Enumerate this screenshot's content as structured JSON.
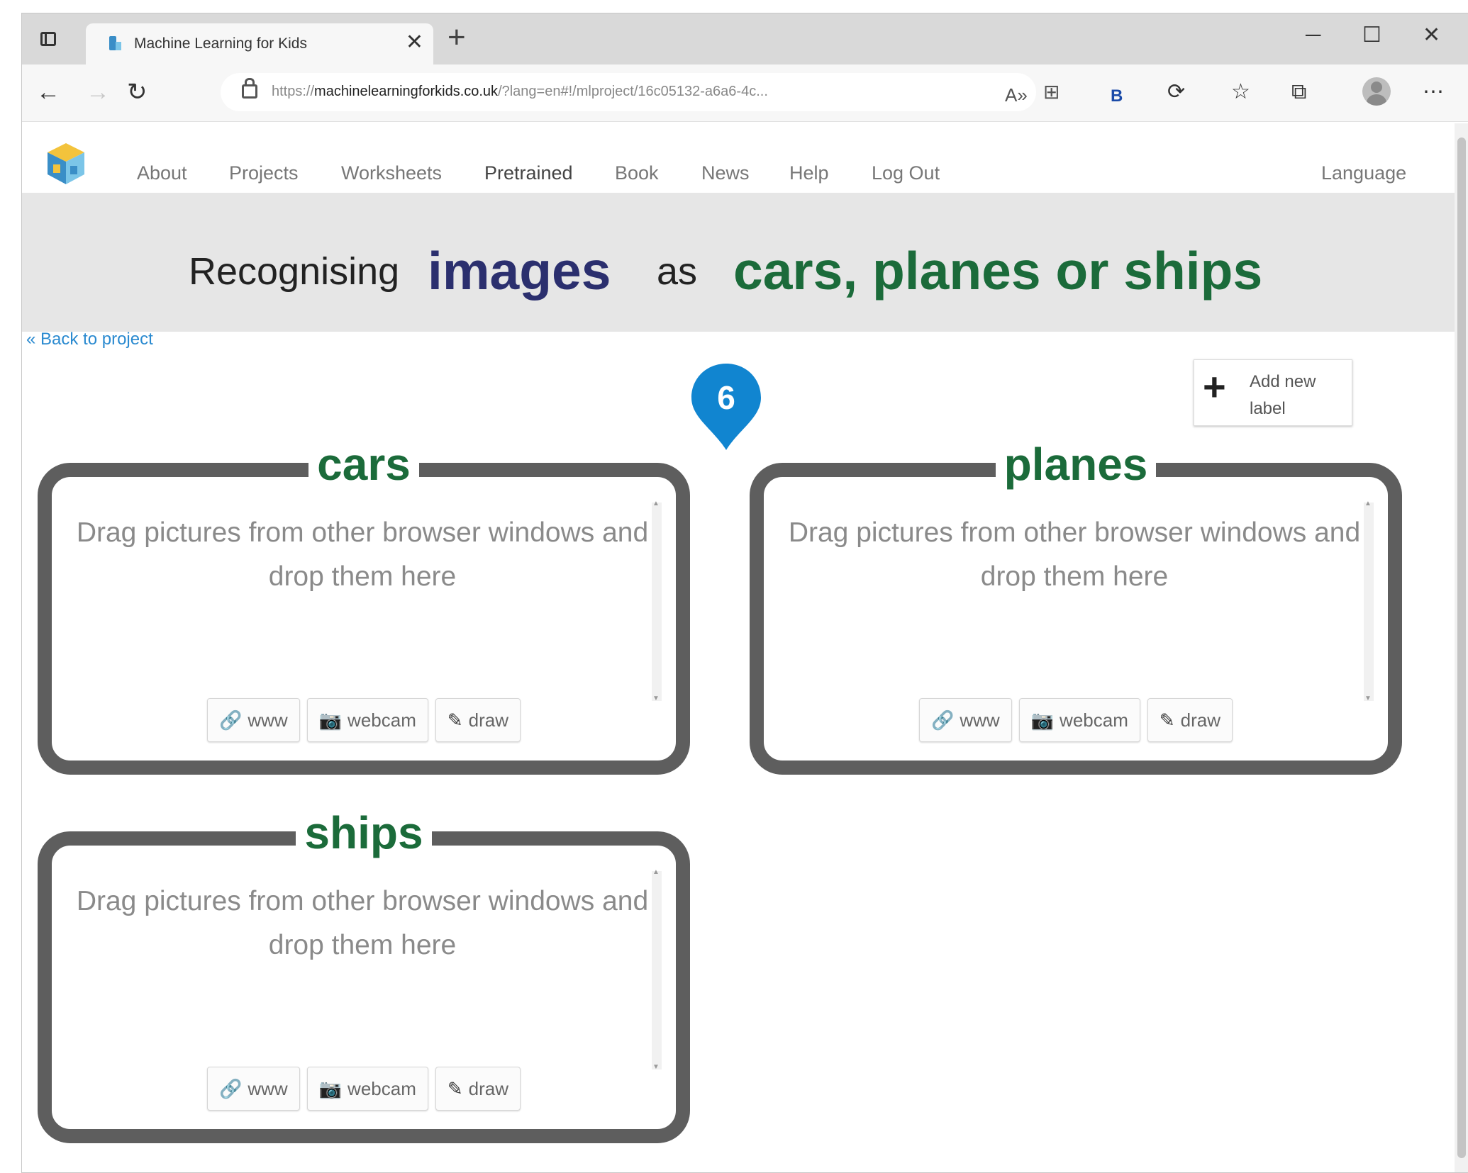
{
  "browser": {
    "tab_title": "Machine Learning for Kids",
    "tab_close": "✕",
    "new_tab": "+",
    "url_prefix": "https://",
    "url_host": "machinelearningforkids.co.uk",
    "url_rest": "/?lang=en#!/mlproject/16c05132-a6a6-4c..."
  },
  "nav": {
    "items": [
      "About",
      "Projects",
      "Worksheets",
      "Pretrained",
      "Book",
      "News",
      "Help",
      "Log Out"
    ],
    "language": "Language"
  },
  "header": {
    "word1": "Recognising",
    "word2": "images",
    "word3": "as",
    "word4": "cars, planes or ships"
  },
  "back_link": "« Back to project",
  "step_badge": "6",
  "add_label": "Add new label",
  "buckets": [
    {
      "title": "cars",
      "drop_text": "Drag pictures from other browser windows and drop them here",
      "buttons": [
        "www",
        "webcam",
        "draw"
      ]
    },
    {
      "title": "planes",
      "drop_text": "Drag pictures from other browser windows and drop them here",
      "buttons": [
        "www",
        "webcam",
        "draw"
      ]
    },
    {
      "title": "ships",
      "drop_text": "Drag pictures from other browser windows and drop them here",
      "buttons": [
        "www",
        "webcam",
        "draw"
      ]
    }
  ],
  "colors": {
    "accent_images": "#2b2f6e",
    "accent_labels": "#1b6b3a",
    "bucket_border": "#5e5e5e",
    "badge": "#1185d0",
    "link": "#2a8ad0"
  },
  "icons": {
    "www": "link-icon",
    "webcam": "camera-icon",
    "draw": "pencil-icon"
  }
}
